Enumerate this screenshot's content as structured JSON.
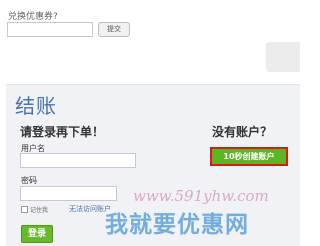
{
  "coupon": {
    "label": "兑换优惠券?",
    "submit_label": "提交"
  },
  "checkout": {
    "title": "结账",
    "login_heading": "请登录再下单！",
    "username_label": "用户名",
    "password_label": "密码",
    "remember_label": "记住我",
    "forgot_label": "无法访问账户",
    "login_button": "登录"
  },
  "signup": {
    "heading": "没有账户？",
    "create_button": "10秒创建账户"
  },
  "watermark": {
    "url": "www.591yhw.com",
    "name": "我就要优惠网"
  },
  "colors": {
    "accent": "#4a74a8",
    "green_button": "#5eb524",
    "highlight": "#e0161d"
  }
}
